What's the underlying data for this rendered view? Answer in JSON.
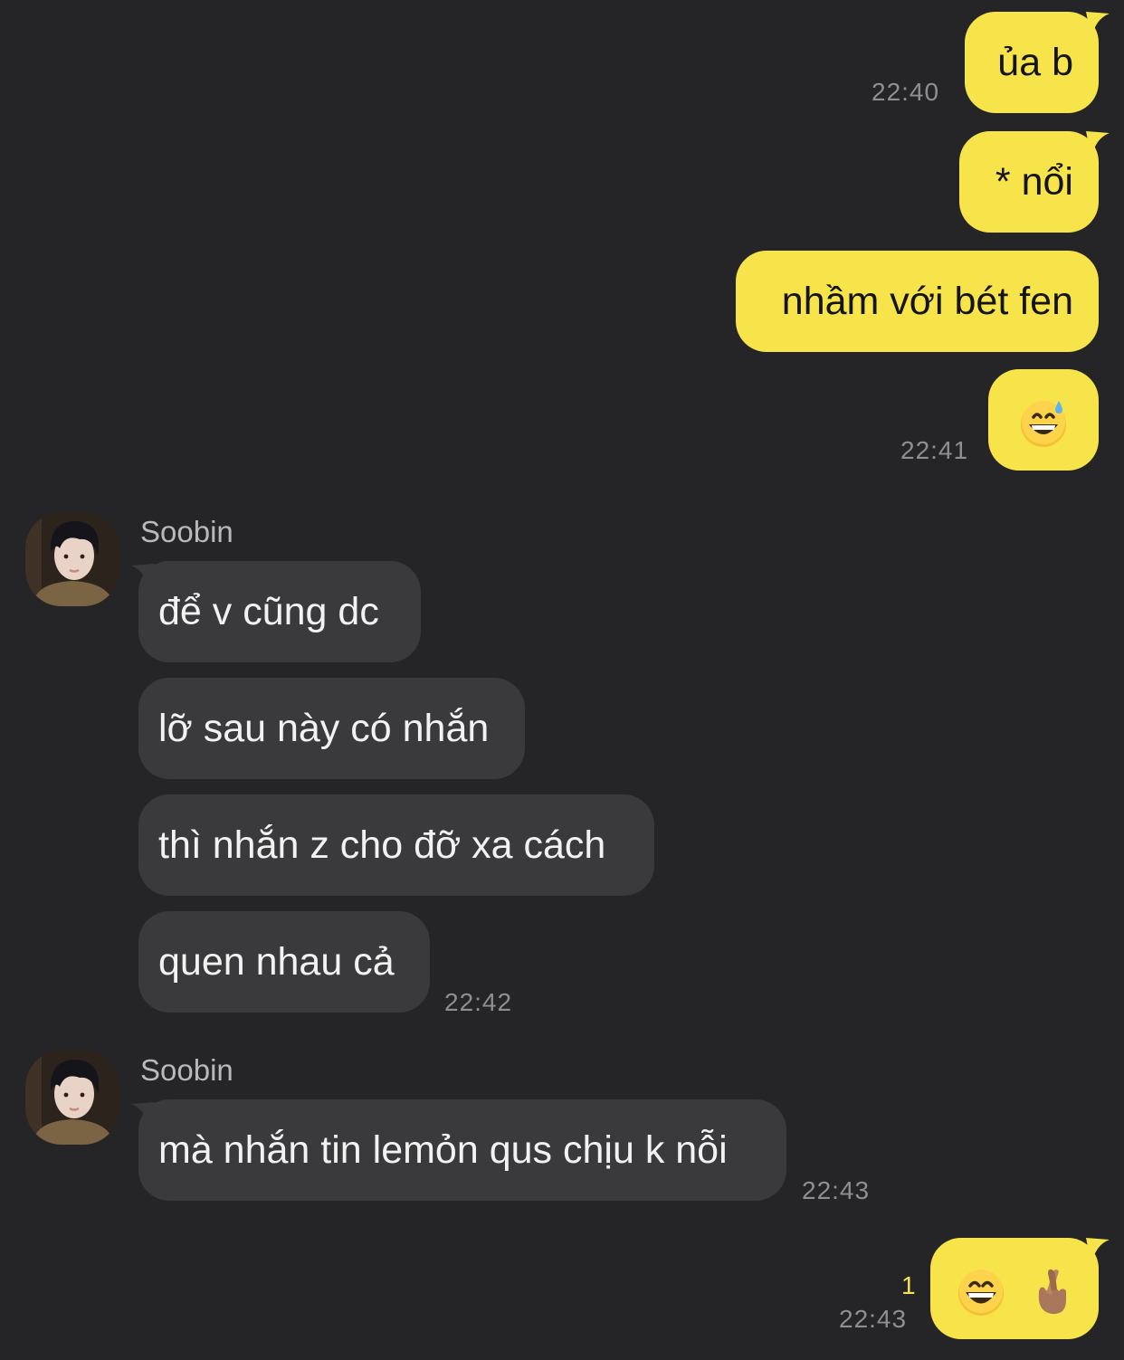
{
  "messages_out_1": [
    {
      "text": "ủa b"
    },
    {
      "text": "* nổi"
    },
    {
      "text": "nhầm với bét fen"
    }
  ],
  "time_1": "22:40",
  "time_2": "22:41",
  "group_in_1": {
    "sender": "Soobin",
    "messages": [
      "để v cũng dc",
      "lỡ sau này có nhắn",
      "thì nhắn z cho đỡ xa cách",
      "quen nhau cả"
    ],
    "time": "22:42"
  },
  "group_in_2": {
    "sender": "Soobin",
    "messages": [
      "mà nhắn tin lemỏn qus chịu k nỗi"
    ],
    "time": "22:43"
  },
  "last_out": {
    "unread_count": "1",
    "time": "22:43",
    "emojis": [
      "grinning-face-emoji",
      "crossed-fingers-emoji"
    ]
  },
  "emoji_reply": "grinning-face-with-sweat-emoji",
  "colors": {
    "background": "#252527",
    "outgoing_bubble": "#f7e34a",
    "incoming_bubble": "#3a3a3c",
    "timestamp": "#8e8e93",
    "unread": "#f7e34a"
  }
}
